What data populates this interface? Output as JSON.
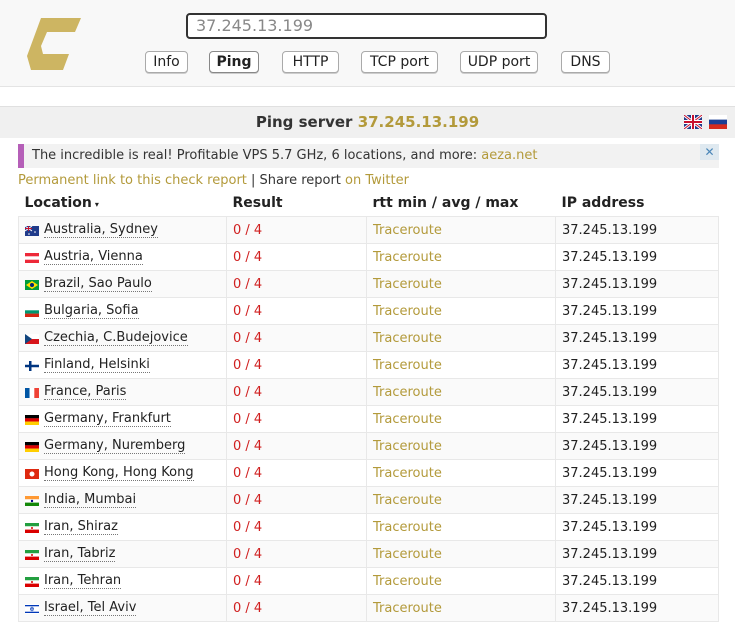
{
  "header": {
    "search_value": "37.245.13.199",
    "tabs": [
      {
        "label": "Info",
        "active": false
      },
      {
        "label": "Ping",
        "active": true
      },
      {
        "label": "HTTP",
        "active": false
      },
      {
        "label": "TCP port",
        "active": false
      },
      {
        "label": "UDP port",
        "active": false
      },
      {
        "label": "DNS",
        "active": false
      }
    ]
  },
  "title": {
    "prefix": "Ping server",
    "ip": "37.245.13.199"
  },
  "languages": [
    "gb-flag-icon",
    "ru-flag-icon"
  ],
  "ad": {
    "text": "The incredible is real! Profitable VPS 5.7 GHz, 6 locations, and more:",
    "link": "aeza.net",
    "close": "✕"
  },
  "share": {
    "permanent_link": "Permanent link to this check report",
    "separator": " | ",
    "share_text": "Share report",
    "twitter": "on Twitter"
  },
  "table": {
    "columns": [
      "Location",
      "Result",
      "rtt min / avg / max",
      "IP address"
    ],
    "sort_glyph": "▾",
    "rows": [
      {
        "location": "Australia, Sydney",
        "flag": "au",
        "result": "0 / 4",
        "rtt": "Traceroute",
        "ip": "37.245.13.199"
      },
      {
        "location": "Austria, Vienna",
        "flag": "at",
        "result": "0 / 4",
        "rtt": "Traceroute",
        "ip": "37.245.13.199"
      },
      {
        "location": "Brazil, Sao Paulo",
        "flag": "br",
        "result": "0 / 4",
        "rtt": "Traceroute",
        "ip": "37.245.13.199"
      },
      {
        "location": "Bulgaria, Sofia",
        "flag": "bg",
        "result": "0 / 4",
        "rtt": "Traceroute",
        "ip": "37.245.13.199"
      },
      {
        "location": "Czechia, C.Budejovice",
        "flag": "cz",
        "result": "0 / 4",
        "rtt": "Traceroute",
        "ip": "37.245.13.199"
      },
      {
        "location": "Finland, Helsinki",
        "flag": "fi",
        "result": "0 / 4",
        "rtt": "Traceroute",
        "ip": "37.245.13.199"
      },
      {
        "location": "France, Paris",
        "flag": "fr",
        "result": "0 / 4",
        "rtt": "Traceroute",
        "ip": "37.245.13.199"
      },
      {
        "location": "Germany, Frankfurt",
        "flag": "de",
        "result": "0 / 4",
        "rtt": "Traceroute",
        "ip": "37.245.13.199"
      },
      {
        "location": "Germany, Nuremberg",
        "flag": "de",
        "result": "0 / 4",
        "rtt": "Traceroute",
        "ip": "37.245.13.199"
      },
      {
        "location": "Hong Kong, Hong Kong",
        "flag": "hk",
        "result": "0 / 4",
        "rtt": "Traceroute",
        "ip": "37.245.13.199"
      },
      {
        "location": "India, Mumbai",
        "flag": "in",
        "result": "0 / 4",
        "rtt": "Traceroute",
        "ip": "37.245.13.199"
      },
      {
        "location": "Iran, Shiraz",
        "flag": "ir",
        "result": "0 / 4",
        "rtt": "Traceroute",
        "ip": "37.245.13.199"
      },
      {
        "location": "Iran, Tabriz",
        "flag": "ir",
        "result": "0 / 4",
        "rtt": "Traceroute",
        "ip": "37.245.13.199"
      },
      {
        "location": "Iran, Tehran",
        "flag": "ir",
        "result": "0 / 4",
        "rtt": "Traceroute",
        "ip": "37.245.13.199"
      },
      {
        "location": "Israel, Tel Aviv",
        "flag": "il",
        "result": "0 / 4",
        "rtt": "Traceroute",
        "ip": "37.245.13.199"
      }
    ]
  },
  "colors": {
    "accent": "#b39a3b",
    "error": "#d02020",
    "ad_bar": "#b55fb8"
  }
}
